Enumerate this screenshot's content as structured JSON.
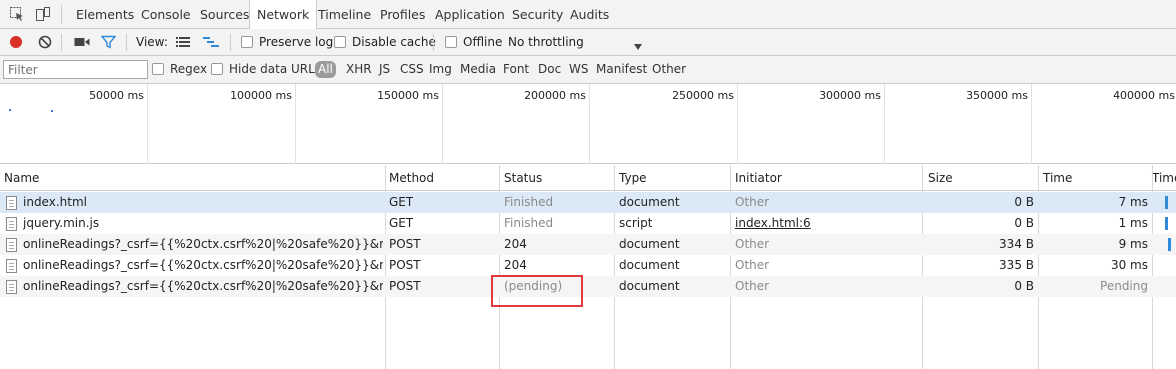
{
  "tabs": [
    "Elements",
    "Console",
    "Sources",
    "Network",
    "Timeline",
    "Profiles",
    "Application",
    "Security",
    "Audits"
  ],
  "active_tab": "Network",
  "toolbar": {
    "view_label": "View:",
    "preserve_log": "Preserve log",
    "disable_cache": "Disable cache",
    "offline": "Offline",
    "throttling": "No throttling"
  },
  "filterbar": {
    "placeholder": "Filter",
    "regex": "Regex",
    "hide_data_urls": "Hide data URLs",
    "types": [
      "All",
      "XHR",
      "JS",
      "CSS",
      "Img",
      "Media",
      "Font",
      "Doc",
      "WS",
      "Manifest",
      "Other"
    ]
  },
  "overview": {
    "labels": [
      "50000 ms",
      "100000 ms",
      "150000 ms",
      "200000 ms",
      "250000 ms",
      "300000 ms",
      "350000 ms",
      "400000 ms"
    ]
  },
  "table": {
    "headers": [
      "Name",
      "Method",
      "Status",
      "Type",
      "Initiator",
      "Size",
      "Time",
      "Time"
    ],
    "rows": [
      {
        "name": "index.html",
        "method": "GET",
        "status": "Finished",
        "type": "document",
        "initiator": "Other",
        "size": "0 B",
        "time": "7 ms"
      },
      {
        "name": "jquery.min.js",
        "method": "GET",
        "status": "Finished",
        "type": "script",
        "initiator": "index.html:6",
        "size": "0 B",
        "time": "1 ms"
      },
      {
        "name": "onlineReadings?_csrf={{%20ctx.csrf%20|%20safe%20}}&method=...",
        "method": "POST",
        "status": "204",
        "type": "document",
        "initiator": "Other",
        "size": "334 B",
        "time": "9 ms"
      },
      {
        "name": "onlineReadings?_csrf={{%20ctx.csrf%20|%20safe%20}}&method=...",
        "method": "POST",
        "status": "204",
        "type": "document",
        "initiator": "Other",
        "size": "335 B",
        "time": "30 ms"
      },
      {
        "name": "onlineReadings?_csrf={{%20ctx.csrf%20|%20safe%20}}&method=...",
        "method": "POST",
        "status": "(pending)",
        "type": "document",
        "initiator": "Other",
        "size": "0 B",
        "time": "Pending"
      }
    ]
  },
  "colors": {
    "record": "#d93025",
    "accent": "#2f8ad8",
    "highlight": "#e03a3a"
  }
}
